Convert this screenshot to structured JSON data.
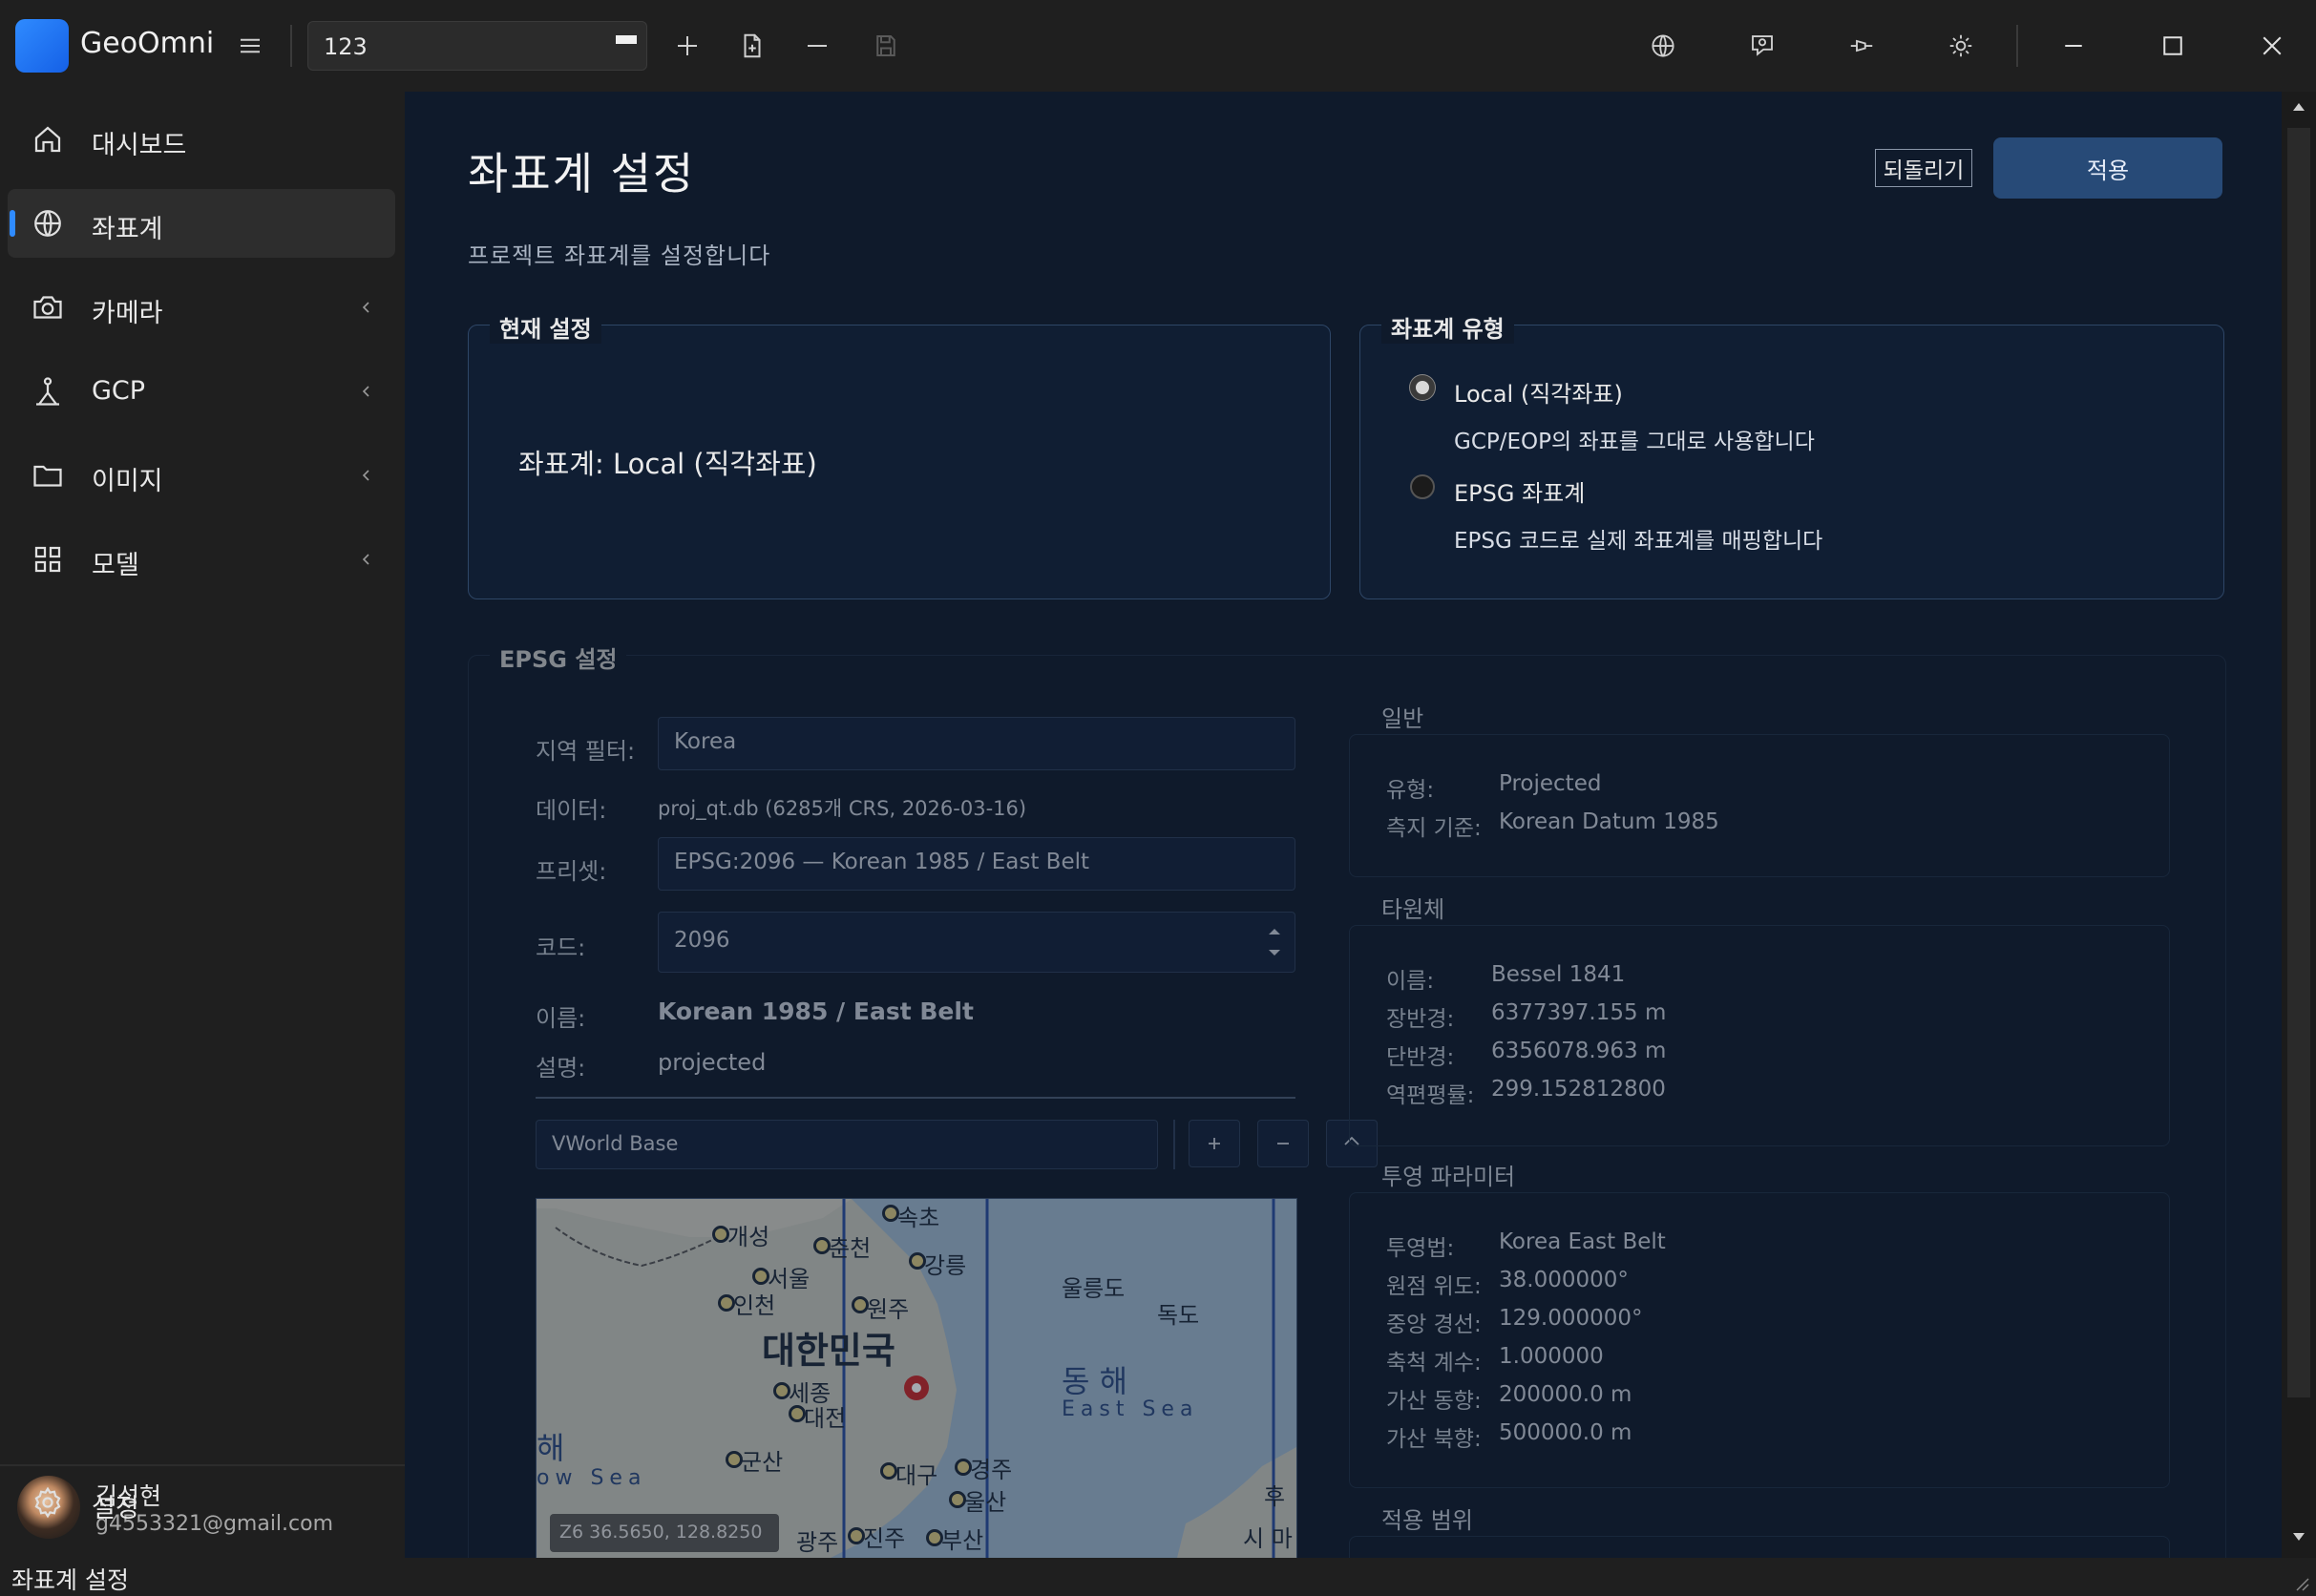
{
  "app": {
    "name": "GeoOmni"
  },
  "toolbar": {
    "project_value": "123"
  },
  "sidebar": {
    "items": [
      {
        "label": "대시보드"
      },
      {
        "label": "좌표계"
      },
      {
        "label": "카메라"
      },
      {
        "label": "GCP"
      },
      {
        "label": "이미지"
      },
      {
        "label": "모델"
      }
    ],
    "user": {
      "name": "김성현",
      "email": "g4553321@gmail.com"
    },
    "settings_label": "설정"
  },
  "status": {
    "text": "좌표계 설정"
  },
  "page": {
    "title": "좌표계 설정",
    "subtitle": "프로젝트 좌표계를 설정합니다",
    "revert_label": "되돌리기",
    "apply_label": "적용"
  },
  "current": {
    "legend": "현재 설정",
    "text": "좌표계: Local (직각좌표)"
  },
  "crs_type": {
    "legend": "좌표계 유형",
    "options": [
      {
        "label": "Local (직각좌표)",
        "desc": "GCP/EOP의 좌표를 그대로 사용합니다",
        "selected": true
      },
      {
        "label": "EPSG 좌표계",
        "desc": "EPSG 코드로 실제 좌표계를 매핑합니다",
        "selected": false
      }
    ]
  },
  "epsg": {
    "legend": "EPSG 설정",
    "region_label": "지역 필터:",
    "region_value": "Korea",
    "data_label": "데이터:",
    "data_value": "proj_qt.db (6285개 CRS, 2026-03-16)",
    "preset_label": "프리셋:",
    "preset_value": "EPSG:2096 — Korean 1985 / East Belt",
    "code_label": "코드:",
    "code_value": "2096",
    "name_label": "이름:",
    "name_value": "Korean 1985 / East Belt",
    "desc_label": "설명:",
    "desc_value": "projected",
    "basemap_value": "VWorld Base",
    "map": {
      "coords": "Z6  36.5650, 128.8250",
      "labels": [
        "개성",
        "춘천",
        "속초",
        "서울",
        "강릉",
        "인천",
        "원주",
        "울릉도",
        "독도",
        "대한민국",
        "세종",
        "대전",
        "동 해",
        "East Sea",
        "군산",
        "대구",
        "경주",
        "울산",
        "진주",
        "부산",
        "광주",
        "해",
        "ow Sea",
        "후",
        "시 마"
      ]
    }
  },
  "general": {
    "title": "일반",
    "type_label": "유형:",
    "type_value": "Projected",
    "datum_label": "측지 기준:",
    "datum_value": "Korean Datum 1985"
  },
  "ellipsoid": {
    "title": "타원체",
    "name_label": "이름:",
    "name_value": "Bessel 1841",
    "major_label": "장반경:",
    "major_value": "6377397.155 m",
    "minor_label": "단반경:",
    "minor_value": "6356078.963 m",
    "flat_label": "역편평률:",
    "flat_value": "299.152812800"
  },
  "projection": {
    "title": "투영 파라미터",
    "method_label": "투영법:",
    "method_value": "Korea East Belt",
    "lat_label": "원점 위도:",
    "lat_value": "38.000000°",
    "lon_label": "중앙 경선:",
    "lon_value": "129.000000°",
    "scale_label": "축척 계수:",
    "scale_value": "1.000000",
    "fe_label": "가산 동향:",
    "fe_value": "200000.0 m",
    "fn_label": "가산 북향:",
    "fn_value": "500000.0 m"
  },
  "scope": {
    "title": "적용 범위"
  },
  "colors": {
    "accent": "#2f8bff",
    "apply_bg": "#274a77",
    "content_bg": "#0f1a2b"
  }
}
